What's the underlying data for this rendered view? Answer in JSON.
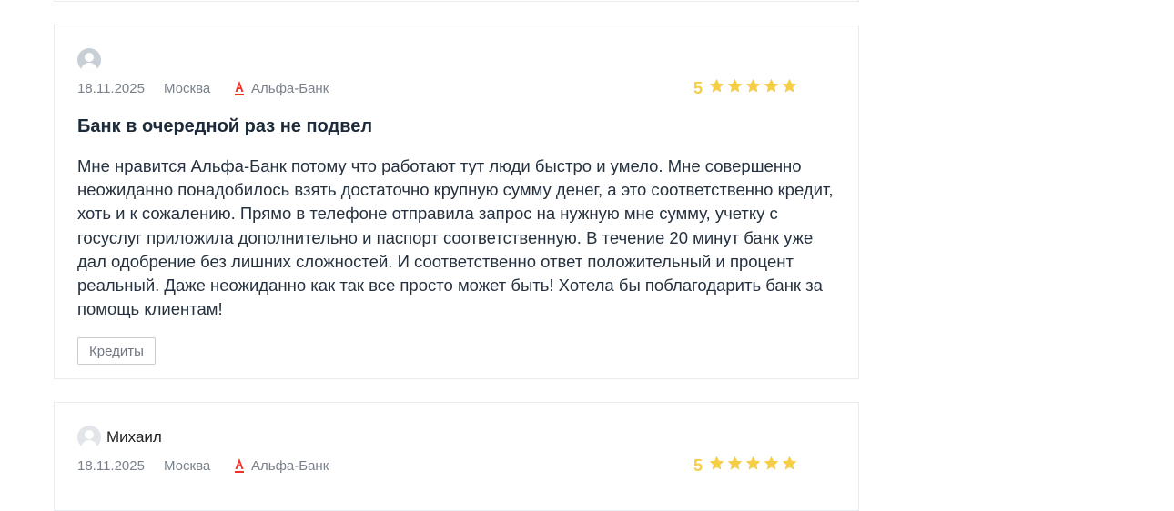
{
  "colors": {
    "star": "#f5cd47",
    "alfa_red": "#ef3124",
    "border": "#e8ebef"
  },
  "reviews": [
    {
      "author": "",
      "date": "18.11.2025",
      "city": "Москва",
      "bank": "Альфа-Банк",
      "rating": "5",
      "stars": 5,
      "title": "Банк в очередной раз не подвел",
      "text": "Мне нравится Альфа-Банк потому что работают тут люди быстро и умело. Мне совершенно неожиданно понадобилось взять достаточно крупную сумму денег, а это соответственно кредит, хоть и к сожалению. Прямо в телефоне отправила запрос на нужную мне сумму, учетку с госуслуг приложила дополнительно и паспорт соответственную. В течение 20 минут банк уже дал одобрение без лишних сложностей. И соответственно ответ положительный и процент реальный. Даже неожиданно как так все просто может быть! Хотела бы поблагодарить банк за помощь клиентам!",
      "tag": "Кредиты"
    },
    {
      "author": "Михаил",
      "date": "18.11.2025",
      "city": "Москва",
      "bank": "Альфа-Банк",
      "rating": "5",
      "stars": 5
    }
  ]
}
